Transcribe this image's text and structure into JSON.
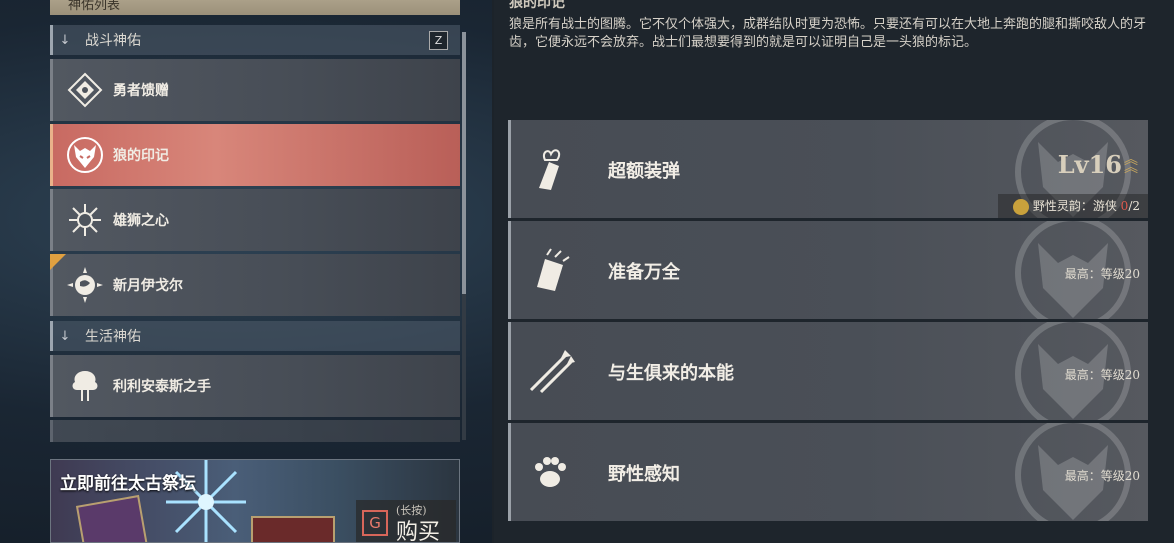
{
  "left": {
    "list_title": "神佑列表",
    "categories": [
      {
        "label": "战斗神佑",
        "key": "Z"
      },
      {
        "label": "生活神佑"
      }
    ],
    "combat_items": [
      {
        "label": "勇者馈赠"
      },
      {
        "label": "狼的印记",
        "selected": true
      },
      {
        "label": "雄狮之心"
      },
      {
        "label": "新月伊戈尔"
      }
    ],
    "life_items": [
      {
        "label": "利利安泰斯之手"
      }
    ]
  },
  "banner": {
    "title": "立即前往太古祭坛",
    "buy_key": "G",
    "buy_hint": "(长按)",
    "buy_label": "购买"
  },
  "detail": {
    "title": "狼的印记",
    "description": "狼是所有战士的图腾。它不仅个体强大，成群结队时更为恐怖。只要还有可以在大地上奔跑的腿和撕咬敌人的牙齿，它便永远不会放弃。战士们最想要得到的就是可以证明自己是一头狼的标记。",
    "skills": [
      {
        "name": "超额装弹",
        "level": "Lv16",
        "sub_label": "野性灵韵：游侠",
        "count_current": "0",
        "count_total": "/2",
        "icon": "torch-fist-icon"
      },
      {
        "name": "准备万全",
        "max": "最高：等级20",
        "icon": "fist-icon"
      },
      {
        "name": "与生俱来的本能",
        "max": "最高：等级20",
        "icon": "arrows-icon"
      },
      {
        "name": "野性感知",
        "max": "最高：等级20",
        "icon": "paw-icon"
      }
    ]
  },
  "colors": {
    "selected": "#c86a62",
    "accent_gold": "#c9a85e",
    "count_red": "#e05a4e"
  }
}
